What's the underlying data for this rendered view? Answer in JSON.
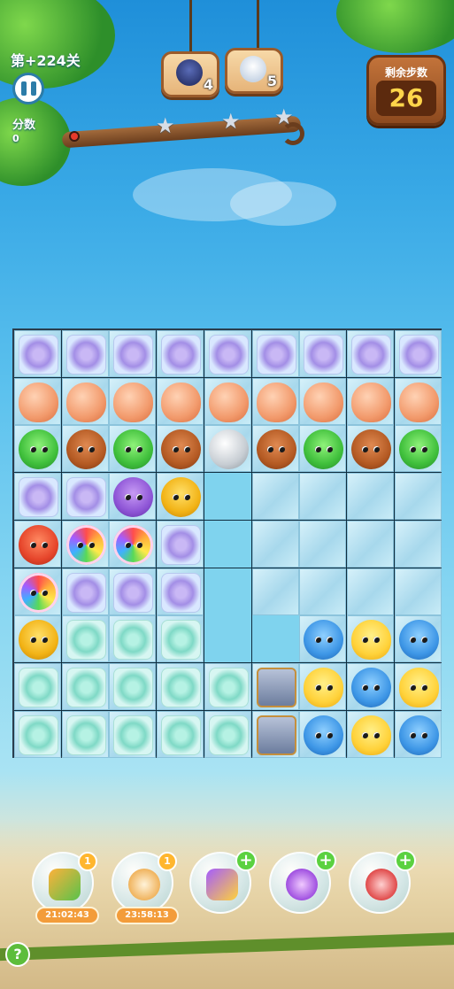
{
  "hud": {
    "level": "第+224关",
    "score_label": "分数",
    "score_value": "0",
    "moves_label": "剩余步数",
    "moves_value": "26"
  },
  "goals": [
    {
      "creature": "penguin",
      "count": "4"
    },
    {
      "creature": "seal",
      "count": "5"
    }
  ],
  "stars": {
    "earned": 0,
    "total": 3
  },
  "board": {
    "columns": 9,
    "rows": 9,
    "legend": {
      "F": "purple-flower-ice-tile",
      "G": "green-flower-ice-tile",
      "E": "orange-egg",
      "R": "green-frog",
      "B": "brown-bear",
      "C": "silver-coin",
      "O": "purple-owl",
      "Y": "yellow-robot",
      "X": "red-fox",
      "W": "rainbow-owl",
      "H": "blue-hippo",
      "K": "yellow-chick",
      "J": "star-jar",
      "I": "empty-ice-cell",
      "V": "empty-space",
      ".": "dark-cell"
    },
    "grid": [
      [
        "F",
        "F",
        "F",
        "F",
        "F",
        "F",
        "F",
        "F",
        "F"
      ],
      [
        "E",
        "E",
        "E",
        "E",
        "E",
        "E",
        "E",
        "E",
        "E"
      ],
      [
        "R",
        "B",
        "R",
        "B",
        "C",
        "B",
        "R",
        "B",
        "R"
      ],
      [
        "F",
        "F",
        "O",
        "Y",
        "V",
        "I",
        "I",
        "I",
        "I"
      ],
      [
        "X",
        "W",
        "W",
        "F",
        "V",
        "I",
        "I",
        "I",
        "I"
      ],
      [
        "W",
        "F",
        "F",
        "F",
        "V",
        "I",
        "I",
        "I",
        "I"
      ],
      [
        "Y",
        "G",
        "G",
        "G",
        "V",
        "V",
        "H",
        "K",
        "H"
      ],
      [
        "G",
        "G",
        "G",
        "G",
        "G",
        "J",
        "K",
        "H",
        "K"
      ],
      [
        "G",
        "G",
        "G",
        "G",
        "G",
        "J",
        "H",
        "K",
        "H"
      ]
    ]
  },
  "boosters": [
    {
      "name": "shuffle-booster",
      "badge": "1",
      "timer": "21:02:43"
    },
    {
      "name": "clock-booster",
      "badge": "1",
      "timer": "23:58:13"
    },
    {
      "name": "swap-booster",
      "badge": "+",
      "timer": ""
    },
    {
      "name": "rocket-booster",
      "badge": "+",
      "timer": ""
    },
    {
      "name": "bomb-booster",
      "badge": "+",
      "timer": ""
    }
  ],
  "help_label": "?"
}
